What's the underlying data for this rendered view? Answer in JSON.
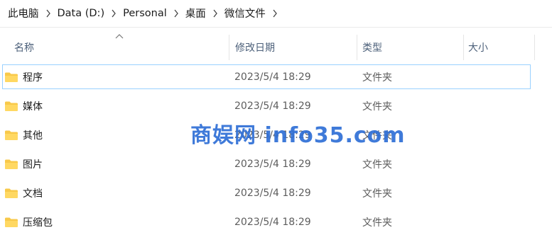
{
  "breadcrumb": [
    "此电脑",
    "Data (D:)",
    "Personal",
    "桌面",
    "微信文件"
  ],
  "columns": {
    "name": "名称",
    "date": "修改日期",
    "type": "类型",
    "size": "大小"
  },
  "rows": [
    {
      "name": "程序",
      "date": "2023/5/4 18:29",
      "type": "文件夹"
    },
    {
      "name": "媒体",
      "date": "2023/5/4 18:29",
      "type": "文件夹"
    },
    {
      "name": "其他",
      "date": "2023/5/4 18:29",
      "type": "文件夹"
    },
    {
      "name": "图片",
      "date": "2023/5/4 18:29",
      "type": "文件夹"
    },
    {
      "name": "文档",
      "date": "2023/5/4 18:29",
      "type": "文件夹"
    },
    {
      "name": "压缩包",
      "date": "2023/5/4 18:29",
      "type": "文件夹"
    }
  ],
  "watermark": "商娱网 info35.com",
  "colors": {
    "selection_border": "#99d1ff",
    "folder": "#f8c94a",
    "watermark": "#2f6fd6"
  }
}
